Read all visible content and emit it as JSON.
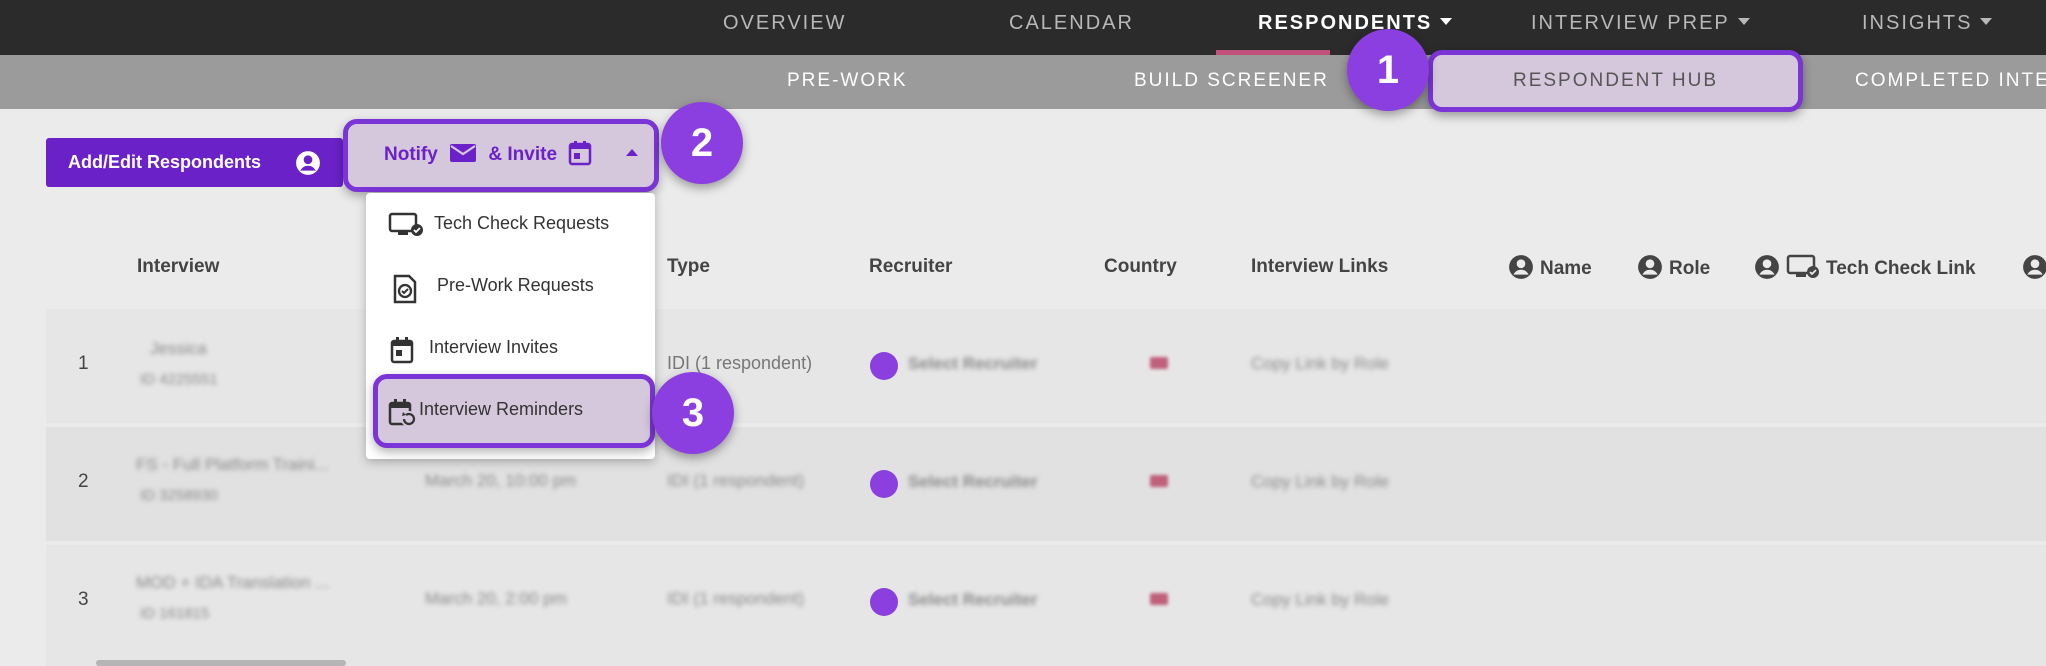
{
  "top_nav": {
    "overview": "OVERVIEW",
    "calendar": "CALENDAR",
    "respondents": "RESPONDENTS",
    "interview_prep": "INTERVIEW PREP",
    "insights": "INSIGHTS"
  },
  "sub_nav": {
    "pre_work": "PRE-WORK",
    "build_screener": "BUILD SCREENER",
    "respondent_hub": "RESPONDENT HUB",
    "completed": "COMPLETED INTE"
  },
  "toolbar": {
    "add_edit_label": "Add/Edit Respondents",
    "notify_label": "Notify",
    "invite_label": "& Invite"
  },
  "dropdown": {
    "items": [
      {
        "label": "Tech Check Requests",
        "icon": "monitor-check-icon"
      },
      {
        "label": "Pre-Work Requests",
        "icon": "document-check-icon"
      },
      {
        "label": "Interview Invites",
        "icon": "calendar-icon"
      },
      {
        "label": "Interview Reminders",
        "icon": "calendar-refresh-icon"
      }
    ]
  },
  "callouts": [
    "1",
    "2",
    "3"
  ],
  "table": {
    "headers": {
      "interview": "Interview",
      "type": "Type",
      "recruiter": "Recruiter",
      "country": "Country",
      "interview_links": "Interview Links",
      "name": "Name",
      "role": "Role",
      "tech_check_link": "Tech Check Link"
    },
    "rows": [
      {
        "num": "1",
        "title": "Jessica",
        "sub": "ID 4225551",
        "date": "",
        "type": "IDI (1 respondent)",
        "recruiter": "Select Recruiter",
        "links": "Copy Link by Role"
      },
      {
        "num": "2",
        "title": "FS - Full Platform Traini...",
        "sub": "ID 3258930",
        "date": "March 20, 10:00 pm",
        "type": "IDI (1 respondent)",
        "recruiter": "Select Recruiter",
        "links": "Copy Link by Role"
      },
      {
        "num": "3",
        "title": "MOD + IDA Translation ...",
        "sub": "ID 161815",
        "date": "March 20, 2:00 pm",
        "type": "IDI (1 respondent)",
        "recruiter": "Select Recruiter",
        "links": "Copy Link by Role"
      }
    ]
  },
  "colors": {
    "accent": "#6a22c8",
    "highlight_border": "#7b34d6",
    "badge": "#8c3fe0",
    "top_nav_bg": "#2b2b2b",
    "sub_nav_bg": "#9b9b9b",
    "active_underline": "#c0517a"
  }
}
